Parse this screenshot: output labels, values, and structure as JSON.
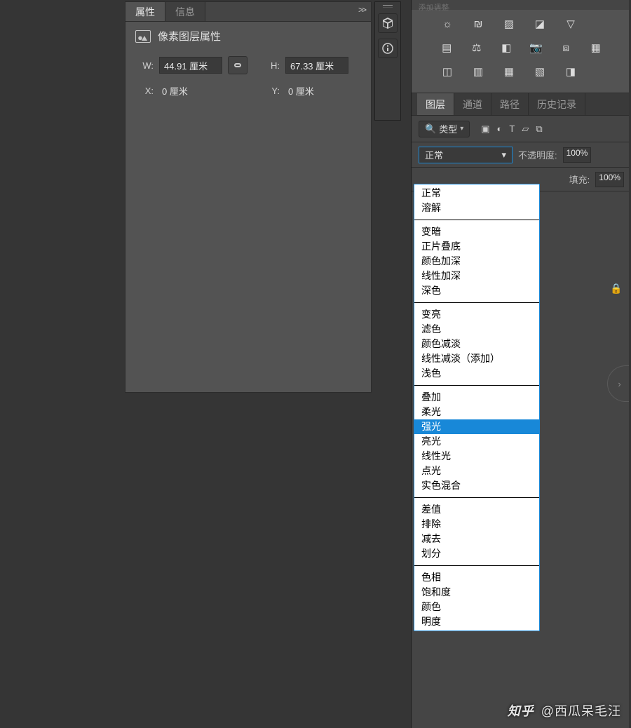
{
  "properties": {
    "tabs": {
      "active": "属性",
      "inactive": "信息"
    },
    "collapse_glyph": ">>",
    "title": "像素图层属性",
    "W_label": "W:",
    "W_value": "44.91 厘米",
    "H_label": "H:",
    "H_value": "67.33 厘米",
    "X_label": "X:",
    "X_value": "0 厘米",
    "Y_label": "Y:",
    "Y_value": "0 厘米"
  },
  "adjust_panel_header": "添加调整",
  "layers": {
    "tabs": [
      "图层",
      "通道",
      "路径",
      "历史记录"
    ],
    "active_tab_index": 0,
    "kind_dropdown": "类型",
    "blend_selected": "正常",
    "opacity_label": "不透明度:",
    "opacity_value": "100%",
    "fill_label": "填充:",
    "fill_value": "100%"
  },
  "blend_modes": {
    "highlighted": "强光",
    "groups": [
      [
        "正常",
        "溶解"
      ],
      [
        "变暗",
        "正片叠底",
        "颜色加深",
        "线性加深",
        "深色"
      ],
      [
        "变亮",
        "滤色",
        "颜色减淡",
        "线性减淡（添加）",
        "浅色"
      ],
      [
        "叠加",
        "柔光",
        "强光",
        "亮光",
        "线性光",
        "点光",
        "实色混合"
      ],
      [
        "差值",
        "排除",
        "减去",
        "划分"
      ],
      [
        "色相",
        "饱和度",
        "颜色",
        "明度"
      ]
    ]
  },
  "credit": {
    "platform": "知乎",
    "at": "@西瓜呆毛汪"
  },
  "icons": {
    "link": "⧉",
    "cube": "◫",
    "info": "ⓘ",
    "search": "🔍",
    "chev_down": "▾",
    "lock": "🔒",
    "img": "▣",
    "adj": "◐",
    "T": "T",
    "shape": "▱",
    "smart": "⧉",
    "grad": "▤",
    "mask": "▥",
    "gray": "▦",
    "camera": "📷",
    "overlap": "⧈",
    "grid": "▦",
    "bright": "☼",
    "hist": "₪",
    "curve": "▨",
    "levels": "◪",
    "tri": "▽",
    "poster": "◫",
    "bal": "⚖",
    "bw": "◧"
  }
}
